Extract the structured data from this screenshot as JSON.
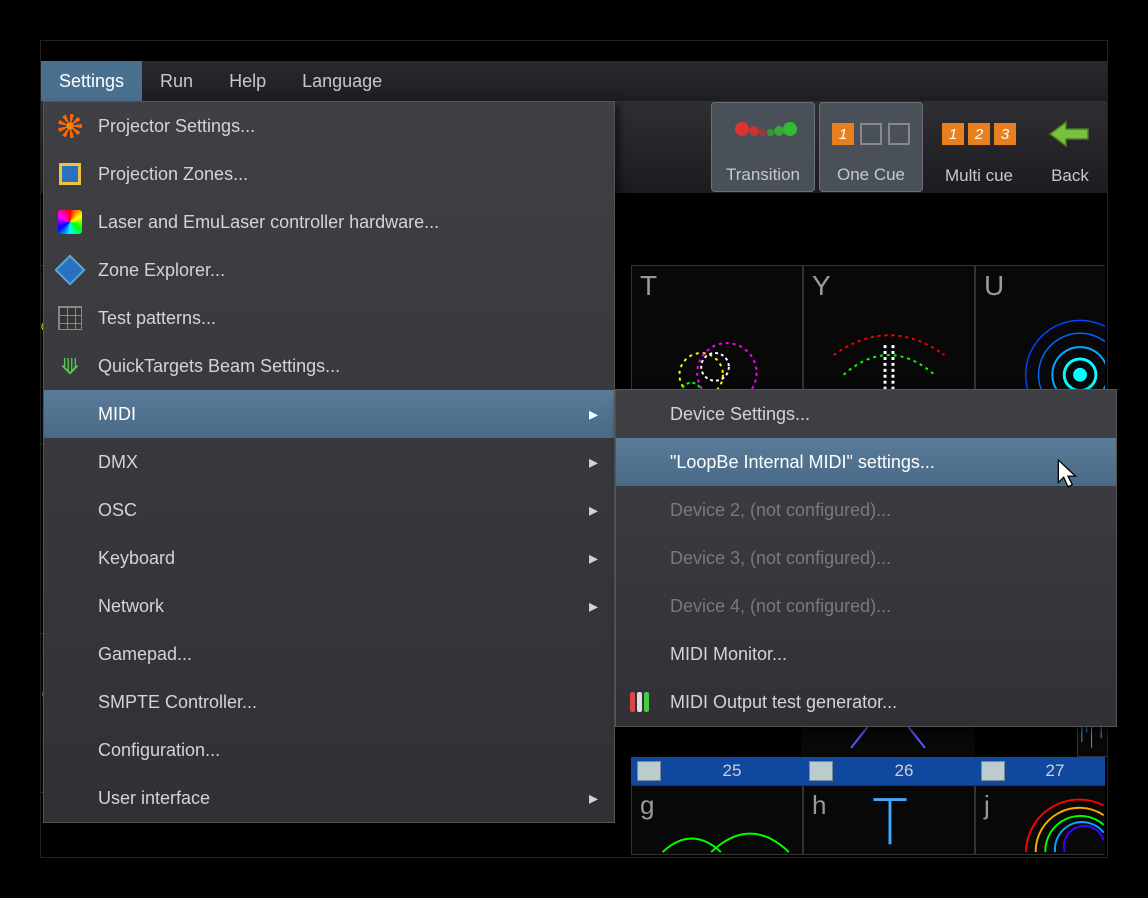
{
  "menubar": {
    "settings": "Settings",
    "run": "Run",
    "help": "Help",
    "language": "Language"
  },
  "toolbar": {
    "transition": "Transition",
    "one_cue": "One Cue",
    "multi_cue": "Multi cue",
    "back": "Back"
  },
  "settings_menu": {
    "items": [
      {
        "label": "Projector Settings...",
        "icon": "projector",
        "arrow": false
      },
      {
        "label": "Projection Zones...",
        "icon": "zones",
        "arrow": false
      },
      {
        "label": "Laser and EmuLaser controller hardware...",
        "icon": "laser",
        "arrow": false
      },
      {
        "label": "Zone Explorer...",
        "icon": "zoneexp",
        "arrow": false
      },
      {
        "label": "Test patterns...",
        "icon": "test",
        "arrow": false
      },
      {
        "label": "QuickTargets Beam Settings...",
        "icon": "beam",
        "arrow": false
      },
      {
        "label": "MIDI",
        "icon": "",
        "arrow": true,
        "hover": true
      },
      {
        "label": "DMX",
        "icon": "",
        "arrow": true
      },
      {
        "label": "OSC",
        "icon": "",
        "arrow": true
      },
      {
        "label": "Keyboard",
        "icon": "",
        "arrow": true
      },
      {
        "label": "Network",
        "icon": "",
        "arrow": true
      },
      {
        "label": "Gamepad...",
        "icon": "",
        "arrow": false
      },
      {
        "label": "SMPTE Controller...",
        "icon": "",
        "arrow": false
      },
      {
        "label": "Configuration...",
        "icon": "",
        "arrow": false
      },
      {
        "label": "User interface",
        "icon": "",
        "arrow": true
      }
    ]
  },
  "midi_submenu": {
    "items": [
      {
        "label": "Device Settings...",
        "icon": "",
        "disabled": false
      },
      {
        "label": "\"LoopBe Internal MIDI\" settings...",
        "icon": "",
        "hover": true
      },
      {
        "label": "Device 2, (not configured)...",
        "icon": "",
        "disabled": true
      },
      {
        "label": "Device 3, (not configured)...",
        "icon": "",
        "disabled": true
      },
      {
        "label": "Device 4, (not configured)...",
        "icon": "",
        "disabled": true
      },
      {
        "label": "MIDI Monitor...",
        "icon": ""
      },
      {
        "label": "MIDI Output test generator...",
        "icon": "output"
      }
    ]
  },
  "cue_grid": {
    "row1_keys": [
      "T",
      "Y",
      "U"
    ],
    "numbers": [
      "25",
      "26",
      "27"
    ],
    "row2_keys": [
      "g",
      "h",
      "j"
    ]
  }
}
